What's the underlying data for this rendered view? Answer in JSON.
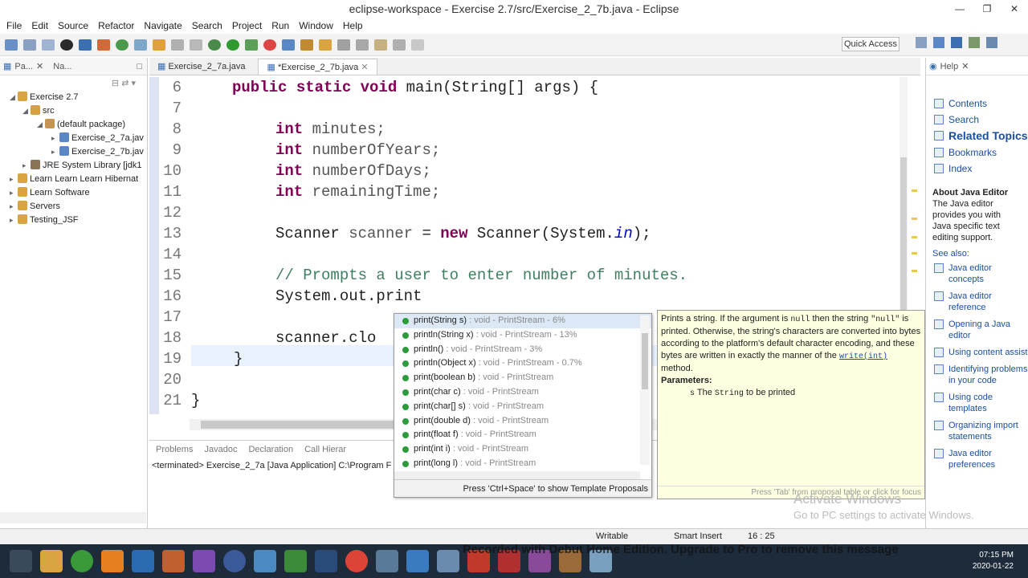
{
  "window": {
    "title": "eclipse-workspace - Exercise 2.7/src/Exercise_2_7b.java - Eclipse"
  },
  "menu": [
    "File",
    "Edit",
    "Source",
    "Refactor",
    "Navigate",
    "Search",
    "Project",
    "Run",
    "Window",
    "Help"
  ],
  "quick_access": "Quick Access",
  "left_panel": {
    "tabs": [
      "Pa...",
      "Na..."
    ],
    "tree": [
      {
        "label": "Exercise 2.7",
        "level": 0,
        "expanded": true
      },
      {
        "label": "src",
        "level": 1,
        "expanded": true
      },
      {
        "label": "(default package)",
        "level": 2,
        "expanded": true
      },
      {
        "label": "Exercise_2_7a.jav",
        "level": 3
      },
      {
        "label": "Exercise_2_7b.jav",
        "level": 3
      },
      {
        "label": "JRE System Library [jdk1",
        "level": 1
      },
      {
        "label": "Learn Learn Learn Hibernat",
        "level": 0
      },
      {
        "label": "Learn Software",
        "level": 0
      },
      {
        "label": "Servers",
        "level": 0
      },
      {
        "label": "Testing_JSF",
        "level": 0
      }
    ]
  },
  "editor": {
    "tabs": [
      "Exercise_2_7a.java",
      "*Exercise_2_7b.java"
    ],
    "lines": [
      "6",
      "7",
      "8",
      "9",
      "10",
      "11",
      "12",
      "13",
      "14",
      "15",
      "16",
      "17",
      "18",
      "19",
      "20",
      "21"
    ],
    "code": {
      "l6_kw": "public static void",
      "l6_rest": " main(String[] args) {",
      "l8_kw": "int",
      "l8_var": " minutes;",
      "l9_kw": "int",
      "l9_var": " numberOfYears;",
      "l10_kw": "int",
      "l10_var": " numberOfDays;",
      "l11_kw": "int",
      "l11_var": " remainingTime;",
      "l13_a": "Scanner ",
      "l13_var": "scanner",
      "l13_b": " = ",
      "l13_kw": "new",
      "l13_c": " Scanner(System.",
      "l13_fld": "in",
      "l13_d": ");",
      "l15": "// Prompts a user to enter number of minutes.",
      "l16": "System.out.print",
      "l18": "scanner.clo",
      "l19": "}",
      "l21": "}"
    }
  },
  "bottom_panel": {
    "tabs": [
      "Problems",
      "Javadoc",
      "Declaration",
      "Call Hierar"
    ],
    "console": "<terminated> Exercise_2_7a [Java Application] C:\\Program F"
  },
  "completion": {
    "items": [
      {
        "name": "print(String s)",
        "ret": " : void - PrintStream - 6%"
      },
      {
        "name": "println(String x)",
        "ret": " : void - PrintStream - 13%"
      },
      {
        "name": "println()",
        "ret": " : void - PrintStream - 3%"
      },
      {
        "name": "println(Object x)",
        "ret": " : void - PrintStream - 0.7%"
      },
      {
        "name": "print(boolean b)",
        "ret": " : void - PrintStream"
      },
      {
        "name": "print(char c)",
        "ret": " : void - PrintStream"
      },
      {
        "name": "print(char[] s)",
        "ret": " : void - PrintStream"
      },
      {
        "name": "print(double d)",
        "ret": " : void - PrintStream"
      },
      {
        "name": "print(float f)",
        "ret": " : void - PrintStream"
      },
      {
        "name": "print(int i)",
        "ret": " : void - PrintStream"
      },
      {
        "name": "print(long l)",
        "ret": " : void - PrintStream"
      }
    ],
    "footer": "Press 'Ctrl+Space' to show Template Proposals"
  },
  "doc": {
    "p1": "Prints a string. If the argument is",
    "null1": "null",
    "p2": "then the string",
    "null2": "\"null\"",
    "p3": "is printed. Otherwise, the string's characters are converted into bytes according to the platform's default character encoding, and these bytes are written in exactly the manner of the",
    "write": "write(int)",
    "p4": "method.",
    "params_label": "Parameters:",
    "param_s": "s",
    "param_desc_a": "The",
    "param_code": "String",
    "param_desc_b": "to be printed",
    "footer": "Press 'Tab' from proposal table or click for focus"
  },
  "help": {
    "tab": "Help",
    "nav": [
      "Contents",
      "Search",
      "Related Topics",
      "Bookmarks",
      "Index"
    ],
    "about_title": "About Java Editor",
    "about_text": "The Java editor provides you with Java specific text editing support.",
    "see_also": "See also:",
    "links": [
      "Java editor concepts",
      "Java editor reference",
      "Opening a Java editor",
      "Using content assist",
      "Identifying problems in your code",
      "Using code templates",
      "Organizing import statements",
      "Java editor preferences"
    ]
  },
  "status": {
    "writable": "Writable",
    "insert": "Smart Insert",
    "position": "16 : 25"
  },
  "overlay": {
    "activate1": "Activate Windows",
    "activate2": "Go to PC settings to activate Windows.",
    "recorded": "Recorded with Debut Home Edition. Upgrade to Pro to remove this message"
  },
  "clock": {
    "time": "07:15 PM",
    "date": "2020-01-22"
  }
}
